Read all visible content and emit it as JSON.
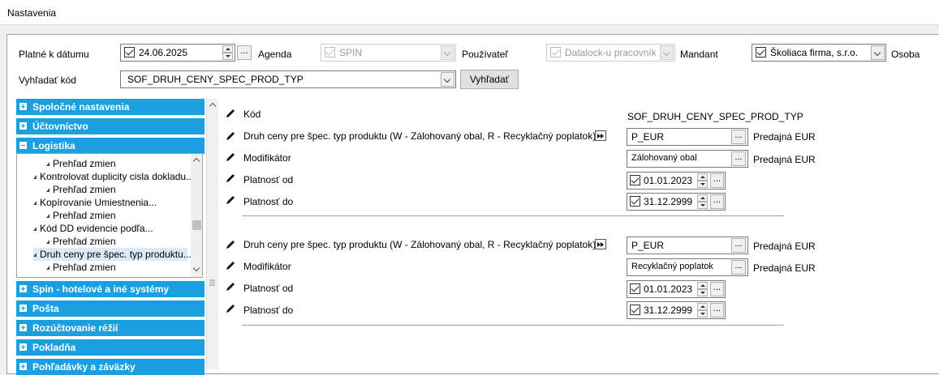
{
  "window": {
    "title": "Nastavenia"
  },
  "filters": {
    "date_label": "Platné k dátumu",
    "date_value": "24.06.2025",
    "agenda_label": "Agenda",
    "agenda_value": "SPIN",
    "user_label": "Používateľ",
    "user_value": "Datalock-u pracovník Ir",
    "mandant_label": "Mandant",
    "mandant_value": "Školiaca firma, s.r.o.",
    "osoba_label": "Osoba",
    "search_label": "Vyhľadať kód",
    "search_value": "SOF_DRUH_CENY_SPEC_PROD_TYP",
    "search_button": "Vyhľadať",
    "ellipsis": "..."
  },
  "sidebar": {
    "categories_top": [
      {
        "label": "Spoločné nastavenia",
        "state": "plus"
      },
      {
        "label": "Účtovníctvo",
        "state": "plus"
      },
      {
        "label": "Logistika",
        "state": "minus"
      }
    ],
    "tree": [
      {
        "label": "Prehľad zmien",
        "level": 2
      },
      {
        "label": "Kontrolovat duplicity cisla dokladu...",
        "level": 1
      },
      {
        "label": "Prehľad zmien",
        "level": 2
      },
      {
        "label": "Kopírovanie Umiestnenia...",
        "level": 1
      },
      {
        "label": "Prehľad zmien",
        "level": 2
      },
      {
        "label": "Kód DD evidencie podľa...",
        "level": 1
      },
      {
        "label": "Prehľad zmien",
        "level": 2
      },
      {
        "label": "Druh ceny pre špec. typ produktu...",
        "level": 1,
        "selected": true
      },
      {
        "label": "Prehľad zmien",
        "level": 2
      }
    ],
    "categories_bottom": [
      {
        "label": "Spin - hotelové a iné systémy",
        "state": "plus"
      },
      {
        "label": "Pošta",
        "state": "plus"
      },
      {
        "label": "Rozúčtovanie réžií",
        "state": "plus"
      },
      {
        "label": "Pokladňa",
        "state": "plus"
      },
      {
        "label": "Pohľadávky a záväzky",
        "state": "plus"
      }
    ]
  },
  "detail": {
    "kod_label": "Kód",
    "kod_value": "SOF_DRUH_CENY_SPEC_PROD_TYP",
    "groups": [
      {
        "druh_label": "Druh ceny pre špec. typ produktu (W - Zálohovaný obal, R - Recyklačný poplatok)",
        "druh_value": "P_EUR",
        "druh_desc": "Predajná EUR",
        "mod_label": "Modifikátor",
        "mod_value": "Zálohovaný obal",
        "mod_desc": "Predajná EUR",
        "od_label": "Platnosť od",
        "od_value": "01.01.2023",
        "do_label": "Platnosť do",
        "do_value": "31.12.2999"
      },
      {
        "druh_label": "Druh ceny pre špec. typ produktu (W - Zálohovaný obal, R - Recyklačný poplatok)",
        "druh_value": "P_EUR",
        "druh_desc": "Predajná EUR",
        "mod_label": "Modifikátor",
        "mod_value": "Recyklačný poplatok",
        "mod_desc": "Predajná EUR",
        "od_label": "Platnosť od",
        "od_value": "01.01.2023",
        "do_label": "Platnosť do",
        "do_value": "31.12.2999"
      }
    ]
  },
  "icons": {
    "pencil": "pencil-icon",
    "checkbox": "checkbox-checked-icon",
    "dropdown": "chevron-down-icon",
    "spinner": "spinner-icon",
    "arrow": "fast-forward-icon"
  },
  "colors": {
    "category_bg": "#1aa0e0",
    "selected_bg": "#d9ebf9"
  }
}
